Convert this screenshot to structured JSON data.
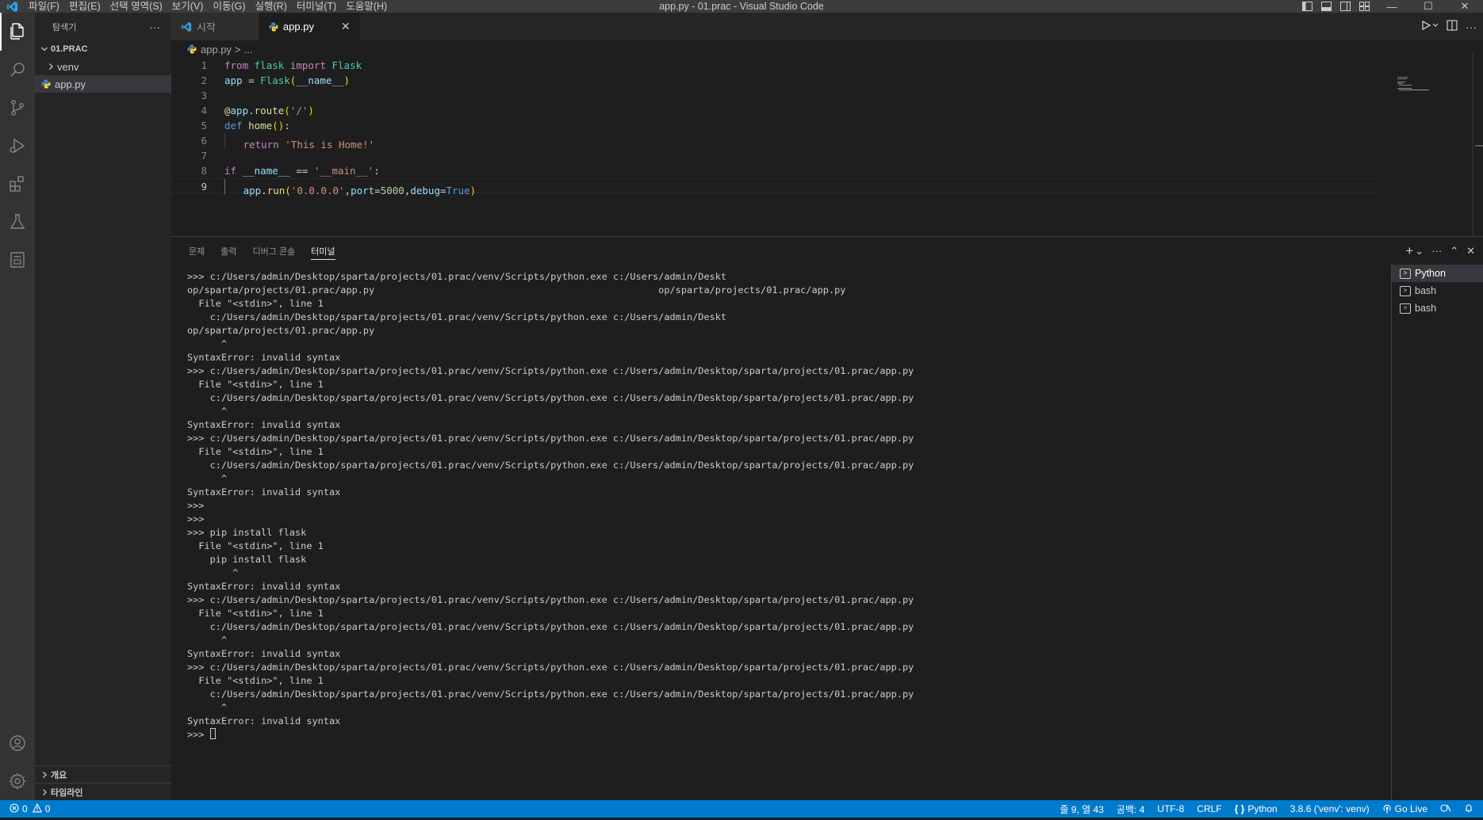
{
  "window": {
    "title": "app.py - 01.prac - Visual Studio Code",
    "menu": [
      "파일(F)",
      "편집(E)",
      "선택 영역(S)",
      "보기(V)",
      "이동(G)",
      "실행(R)",
      "터미널(T)",
      "도움말(H)"
    ],
    "controls": {
      "minimize": "—",
      "maximize": "☐",
      "close": "✕"
    }
  },
  "activity_bar": {
    "items": [
      "explorer-icon",
      "search-icon",
      "source-control-icon",
      "run-debug-icon",
      "extensions-icon",
      "testing-icon",
      "remote-explorer-icon"
    ],
    "bottom": [
      "account-icon",
      "manage-gear-icon"
    ]
  },
  "sidebar": {
    "title": "탐색기",
    "more": "···",
    "folder": "01.PRAC",
    "items": [
      {
        "label": "venv",
        "type": "folder"
      },
      {
        "label": "app.py",
        "type": "file",
        "selected": true
      }
    ],
    "bottom_sections": [
      "개요",
      "타임라인"
    ]
  },
  "editor": {
    "tabs": [
      {
        "label": "시작",
        "active": false
      },
      {
        "label": "app.py",
        "active": true,
        "close": "✕"
      }
    ],
    "breadcrumb": {
      "file": "app.py",
      "separator": ">",
      "rest": "..."
    },
    "line_numbers": [
      "1",
      "2",
      "3",
      "4",
      "5",
      "6",
      "7",
      "8",
      "9"
    ],
    "current_line": 9,
    "code": [
      "from flask import Flask",
      "app = Flask(__name__)",
      "",
      "@app.route('/')",
      "def home():",
      "    return 'This is Home!'",
      "",
      "if __name__ == '__main__':",
      "    app.run('0.0.0.0',port=5000,debug=True)"
    ]
  },
  "panel": {
    "tabs": [
      "문제",
      "출력",
      "디버그 콘솔",
      "터미널"
    ],
    "active_tab": "터미널",
    "actions": {
      "add": "+",
      "chevron": "⌄",
      "more": "···",
      "maximize": "⌃",
      "close": "✕"
    },
    "terminal_lines": [
      ">>> c:/Users/admin/Desktop/sparta/projects/01.prac/venv/Scripts/python.exe c:/Users/admin/Deskt",
      "op/sparta/projects/01.prac/app.py                                                  op/sparta/projects/01.prac/app.py",
      "  File \"<stdin>\", line 1",
      "    c:/Users/admin/Desktop/sparta/projects/01.prac/venv/Scripts/python.exe c:/Users/admin/Deskt",
      "op/sparta/projects/01.prac/app.py",
      "      ^",
      "SyntaxError: invalid syntax",
      ">>> c:/Users/admin/Desktop/sparta/projects/01.prac/venv/Scripts/python.exe c:/Users/admin/Desktop/sparta/projects/01.prac/app.py",
      "  File \"<stdin>\", line 1",
      "    c:/Users/admin/Desktop/sparta/projects/01.prac/venv/Scripts/python.exe c:/Users/admin/Desktop/sparta/projects/01.prac/app.py",
      "      ^",
      "SyntaxError: invalid syntax",
      ">>> c:/Users/admin/Desktop/sparta/projects/01.prac/venv/Scripts/python.exe c:/Users/admin/Desktop/sparta/projects/01.prac/app.py",
      "  File \"<stdin>\", line 1",
      "    c:/Users/admin/Desktop/sparta/projects/01.prac/venv/Scripts/python.exe c:/Users/admin/Desktop/sparta/projects/01.prac/app.py",
      "      ^",
      "SyntaxError: invalid syntax",
      ">>>",
      ">>>",
      ">>> pip install flask",
      "  File \"<stdin>\", line 1",
      "    pip install flask",
      "        ^",
      "SyntaxError: invalid syntax",
      ">>> c:/Users/admin/Desktop/sparta/projects/01.prac/venv/Scripts/python.exe c:/Users/admin/Desktop/sparta/projects/01.prac/app.py",
      "  File \"<stdin>\", line 1",
      "    c:/Users/admin/Desktop/sparta/projects/01.prac/venv/Scripts/python.exe c:/Users/admin/Desktop/sparta/projects/01.prac/app.py",
      "      ^",
      "SyntaxError: invalid syntax",
      ">>> c:/Users/admin/Desktop/sparta/projects/01.prac/venv/Scripts/python.exe c:/Users/admin/Desktop/sparta/projects/01.prac/app.py",
      "  File \"<stdin>\", line 1",
      "    c:/Users/admin/Desktop/sparta/projects/01.prac/venv/Scripts/python.exe c:/Users/admin/Desktop/sparta/projects/01.prac/app.py",
      "      ^",
      "SyntaxError: invalid syntax"
    ],
    "prompt": ">>> ",
    "terminals": [
      {
        "label": "Python",
        "active": true
      },
      {
        "label": "bash",
        "active": false
      },
      {
        "label": "bash",
        "active": false
      }
    ]
  },
  "status_bar": {
    "errors": "0",
    "warnings": "0",
    "position": "줄 9, 열 43",
    "spaces": "공백: 4",
    "encoding": "UTF-8",
    "eol": "CRLF",
    "language": "Python",
    "interpreter": "3.8.6 ('venv': venv)",
    "go_live": "Go Live"
  },
  "colors": {
    "accent": "#007acc",
    "editor_bg": "#1e1e1e",
    "sidebar_bg": "#252526",
    "activity_bg": "#333333"
  }
}
